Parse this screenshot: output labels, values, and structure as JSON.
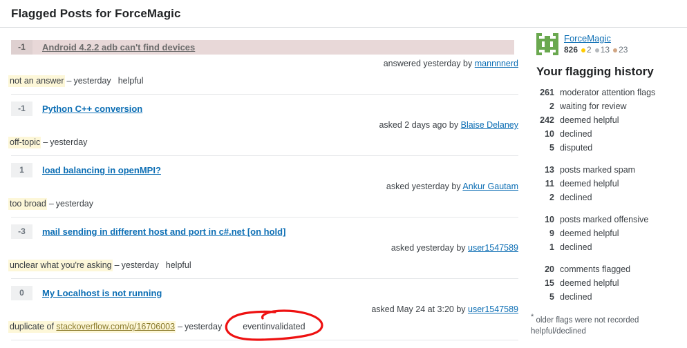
{
  "header": {
    "title": "Flagged Posts for ForceMagic"
  },
  "posts": [
    {
      "score": "-1",
      "title": "Android 4.2.2 adb can't find devices",
      "highlighted": true,
      "muted_title": true,
      "meta_prefix": "answered yesterday by",
      "meta_user": "mannnnerd",
      "flag_reason": "not an answer",
      "flag_dash": "–",
      "flag_time": "yesterday",
      "flag_extra": "helpful",
      "circled": false
    },
    {
      "score": "-1",
      "title": "Python C++ conversion",
      "highlighted": false,
      "muted_title": false,
      "meta_prefix": "asked 2 days ago by",
      "meta_user": "Blaise Delaney",
      "flag_reason": "off-topic",
      "flag_dash": "–",
      "flag_time": "yesterday",
      "flag_extra": "",
      "circled": false
    },
    {
      "score": "1",
      "title": "load balancing in openMPI?",
      "highlighted": false,
      "muted_title": false,
      "meta_prefix": "asked yesterday by",
      "meta_user": "Ankur Gautam",
      "flag_reason": "too broad",
      "flag_dash": "–",
      "flag_time": "yesterday",
      "flag_extra": "",
      "circled": false
    },
    {
      "score": "-3",
      "title": "mail sending in different host and port in c#.net [on hold]",
      "highlighted": false,
      "muted_title": false,
      "meta_prefix": "asked yesterday by",
      "meta_user": "user1547589",
      "flag_reason": "unclear what you're asking",
      "flag_dash": "–",
      "flag_time": "yesterday",
      "flag_extra": "helpful",
      "circled": false
    },
    {
      "score": "0",
      "title": "My Localhost is not running",
      "highlighted": false,
      "muted_title": false,
      "meta_prefix": "asked May 24 at 3:20 by",
      "meta_user": "user1547589",
      "flag_reason_prefix": "duplicate of ",
      "flag_reason_link": "stackoverflow.com/q/16706003",
      "flag_reason": "duplicate of stackoverflow.com/q/16706003",
      "flag_dash": "–",
      "flag_time": "yesterday",
      "flag_extra": "eventinvalidated",
      "circled": true
    }
  ],
  "sidebar": {
    "user": {
      "name": "ForceMagic",
      "reputation": "826",
      "badges": {
        "gold": "2",
        "silver": "13",
        "bronze": "23"
      },
      "avatar_icon": "identicon-avatar"
    },
    "history_title": "Your flagging history",
    "groups": [
      {
        "rows": [
          {
            "num": "261",
            "label": "moderator attention flags"
          },
          {
            "num": "2",
            "label": "waiting for review"
          },
          {
            "num": "242",
            "label": "deemed helpful"
          },
          {
            "num": "10",
            "label": "declined"
          },
          {
            "num": "5",
            "label": "disputed"
          }
        ]
      },
      {
        "rows": [
          {
            "num": "13",
            "label": "posts marked spam"
          },
          {
            "num": "11",
            "label": "deemed helpful"
          },
          {
            "num": "2",
            "label": "declined"
          }
        ]
      },
      {
        "rows": [
          {
            "num": "10",
            "label": "posts marked offensive"
          },
          {
            "num": "9",
            "label": "deemed helpful"
          },
          {
            "num": "1",
            "label": "declined"
          }
        ]
      },
      {
        "rows": [
          {
            "num": "20",
            "label": "comments flagged"
          },
          {
            "num": "15",
            "label": "deemed helpful"
          },
          {
            "num": "5",
            "label": "declined"
          }
        ]
      }
    ],
    "note_marker": "*",
    "note": " older flags were not recorded helpful/declined"
  },
  "annotation": {
    "shape": "hand-drawn-red-ellipse",
    "color": "#ee1111",
    "target_text": "eventinvalidated"
  },
  "colors": {
    "link": "#0c6eb4",
    "highlight_row": "#e8d8d8",
    "flag_highlight": "#fdf7d8",
    "gold": "#ffcc01",
    "silver": "#b4b8bc",
    "bronze": "#d1a684",
    "annotation_red": "#ee1111"
  }
}
